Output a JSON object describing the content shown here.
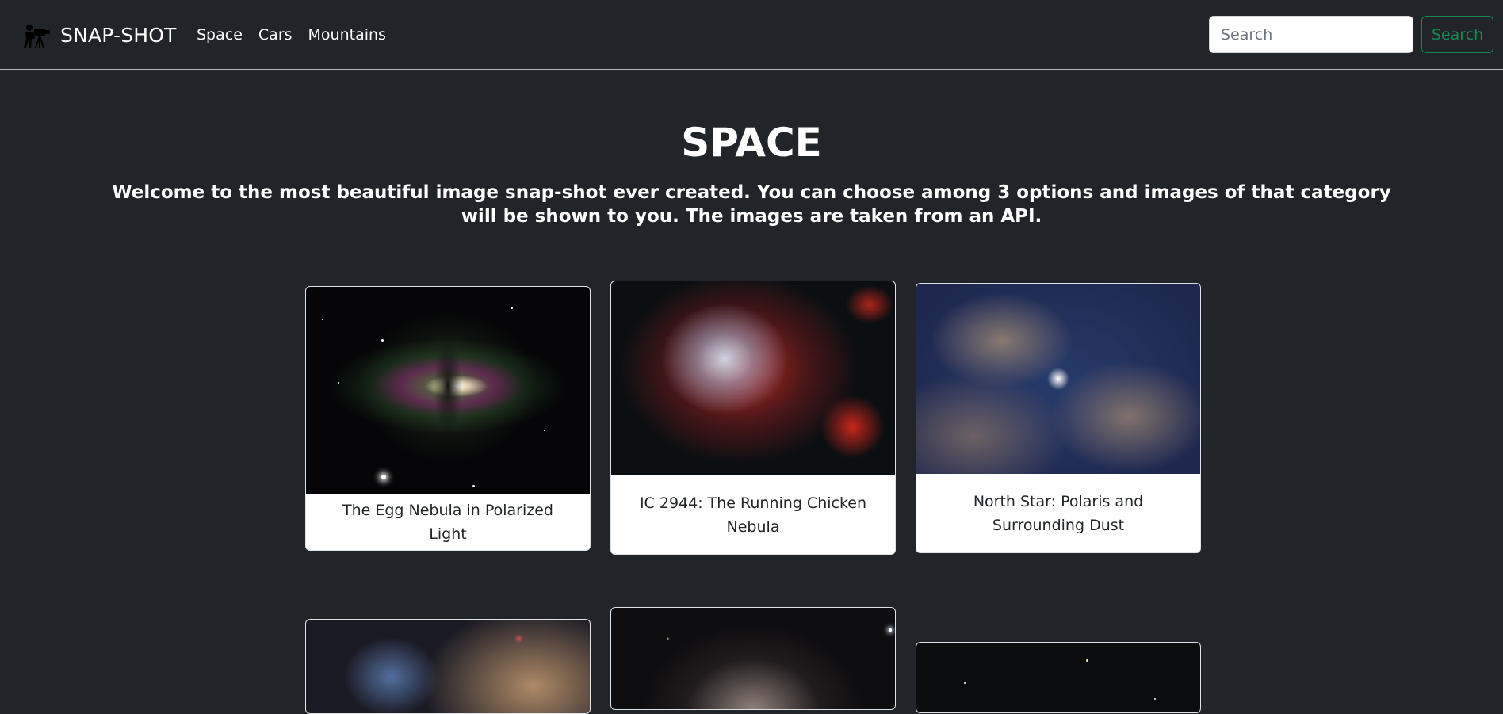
{
  "navbar": {
    "brand": "SNAP-SHOT",
    "brand_icon": "photographer-camera-icon",
    "links": [
      "Space",
      "Cars",
      "Mountains"
    ],
    "search_placeholder": "Search",
    "search_button": "Search"
  },
  "hero": {
    "title": "SPACE",
    "intro": "Welcome to the most beautiful image snap-shot ever created. You can choose among 3 options and images of that category will be shown to you. The images are taken from an API."
  },
  "cards": [
    {
      "title": "The Egg Nebula in Polarized Light"
    },
    {
      "title": "IC 2944: The Running Chicken Nebula"
    },
    {
      "title": "North Star: Polaris and Surrounding Dust"
    },
    {
      "title": ""
    },
    {
      "title": ""
    },
    {
      "title": ""
    }
  ],
  "colors": {
    "background": "#212529",
    "search_button": "#198754",
    "card_background": "#ffffff"
  }
}
